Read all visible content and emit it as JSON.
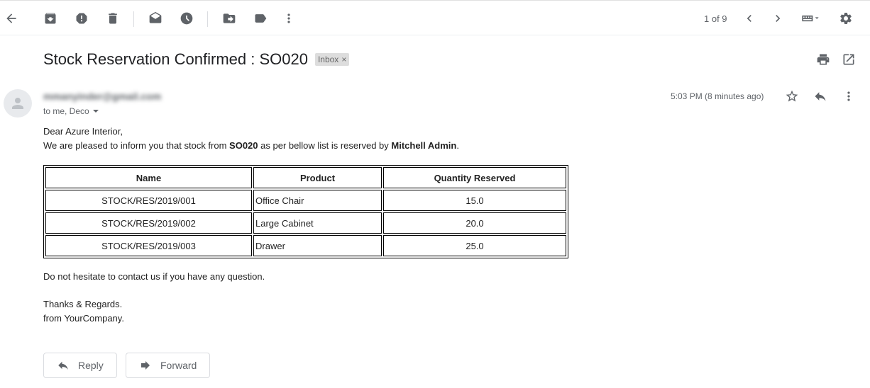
{
  "toolbar": {
    "pager_text": "1 of 9"
  },
  "message": {
    "subject": "Stock Reservation Confirmed : SO020",
    "label": "Inbox",
    "label_remove": "×",
    "sender": "mmanyinder@gmail.com",
    "recipients": "to me, Deco",
    "timestamp": "5:03 PM (8 minutes ago)"
  },
  "content": {
    "greeting": "Dear Azure Interior,",
    "intro_1": "We are pleased to inform you that stock from ",
    "order": "SO020",
    "intro_2": " as per bellow list is reserved by ",
    "admin": "Mitchell Admin",
    "intro_3": ".",
    "headers": [
      "Name",
      "Product",
      "Quantity Reserved"
    ],
    "rows": [
      [
        "STOCK/RES/2019/001",
        "Office Chair",
        "15.0"
      ],
      [
        "STOCK/RES/2019/002",
        "Large Cabinet",
        "20.0"
      ],
      [
        "STOCK/RES/2019/003",
        "Drawer",
        "25.0"
      ]
    ],
    "closing": "Do not hesitate to contact us if you have any question.",
    "regards": "Thanks & Regards.",
    "from": "from YourCompany."
  },
  "actions": {
    "reply": "Reply",
    "forward": "Forward"
  }
}
